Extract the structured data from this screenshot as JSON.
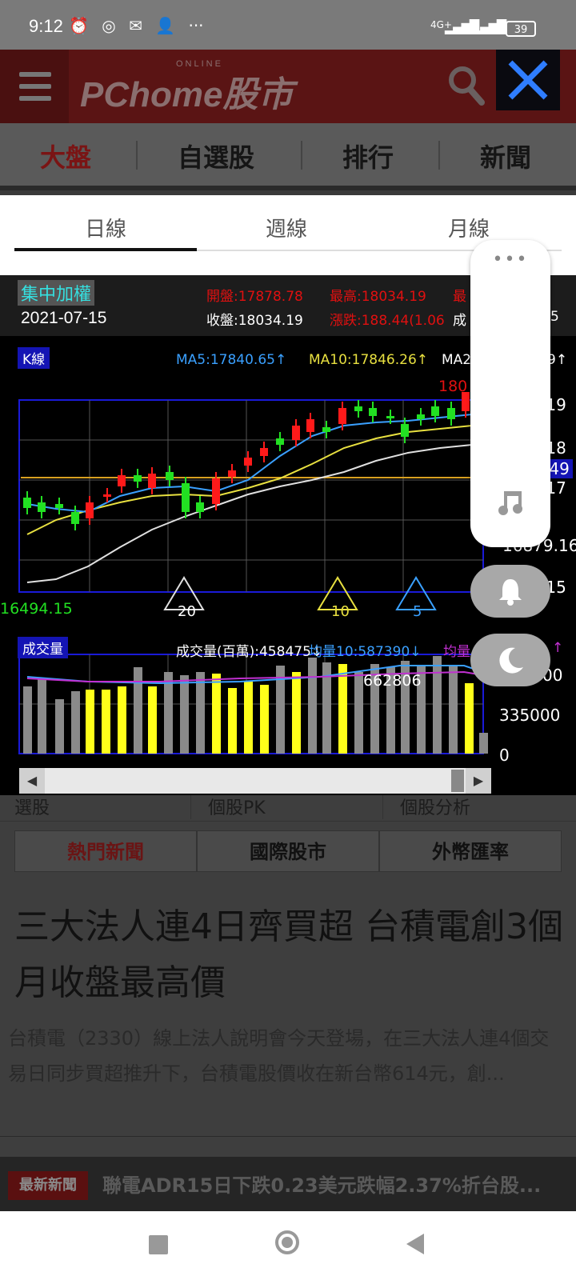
{
  "status_bar": {
    "time": "9:12",
    "network": "4G+",
    "battery": "39",
    "more": "···"
  },
  "header": {
    "logo_small": "ONLINE",
    "logo_main": "PChome股市"
  },
  "nav_tabs": [
    "大盤",
    "自選股",
    "排行",
    "新聞"
  ],
  "period_tabs": [
    "日線",
    "週線",
    "月線"
  ],
  "chart_info": {
    "index_name": "集中加權",
    "date": "2021-07-15",
    "open": "開盤:17878.78",
    "high": "最高:18034.19",
    "low": "最",
    "close": "收盤:18034.19",
    "change": "漲跌:188.44(1.06",
    "volume_short": "成",
    "volume_tail": "5"
  },
  "kline": {
    "label": "K線",
    "ma5": "MA5:17840.65↑",
    "ma10": "MA10:17846.26↑",
    "ma20": "MA2",
    "ma20_tail": "9↑",
    "high_label": "180",
    "y_labels": [
      ".19",
      ".18",
      ".17",
      "16879.16",
      ".15"
    ],
    "current_tag": ".49",
    "low_label": "16494.15",
    "marker_20": "20",
    "marker_10": "10",
    "marker_5": "5"
  },
  "volume": {
    "label": "成交量",
    "amount": "成交量(百萬):458475↓",
    "ma10": "均量10:587390↓",
    "avg": "均量",
    "avg_tail": "↑",
    "peak_label": "662806",
    "y_labels": [
      "00",
      "335000",
      "0"
    ]
  },
  "chart_data": [
    {
      "type": "candlestick",
      "title": "K線",
      "y_low_label": "16494.15",
      "y_tick_labels": [
        "16879.16"
      ],
      "series_colors": {
        "up": "#ff1a1a",
        "down": "#22e022",
        "ma5": "#3aa0ff",
        "ma10": "#e8e040",
        "ma20": "#e0e0e0"
      }
    },
    {
      "type": "bar",
      "title": "成交量",
      "y_tick_labels": [
        "335000",
        "0"
      ],
      "peak_value": 662806
    }
  ],
  "lower": {
    "subtabs_top": [
      "選股",
      "個股PK",
      "個股分析"
    ],
    "subtabs": [
      "熱門新聞",
      "國際股市",
      "外幣匯率"
    ],
    "headline": "三大法人連4日齊買超 台積電創3個月收盤最高價",
    "summary": "台積電（2330）線上法人說明會今天登場，在三大法人連4個交易日同步買超推升下，台積電股價收在新台幣614元，創...",
    "ticker_badge": "最新新聞",
    "ticker_text": "聯電ADR15日下跌0.23美元跌幅2.37%折台股..."
  },
  "colors": {
    "accent": "#2f7dff",
    "active_tab": "#8a1a1a"
  }
}
